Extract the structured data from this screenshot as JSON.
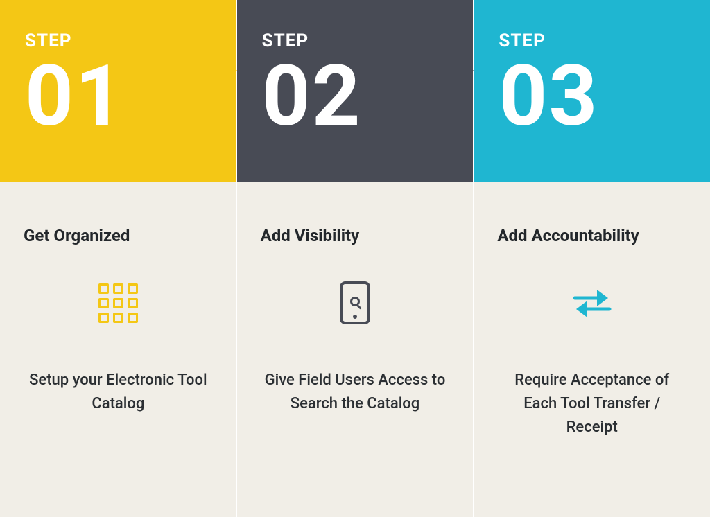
{
  "steps": [
    {
      "kicker": "STEP",
      "number": "01",
      "title": "Get Organized",
      "icon": "grid-icon",
      "description": "Setup your Electronic Tool Catalog",
      "color": "#f4c715"
    },
    {
      "kicker": "STEP",
      "number": "02",
      "title": "Add Visibility",
      "icon": "phone-search-icon",
      "description": "Give Field Users Access to Search the Catalog",
      "color": "#484b55"
    },
    {
      "kicker": "STEP",
      "number": "03",
      "title": "Add Accountability",
      "icon": "swap-arrows-icon",
      "description": "Require Acceptance of Each Tool Transfer / Receipt",
      "color": "#1fb6d1"
    }
  ]
}
